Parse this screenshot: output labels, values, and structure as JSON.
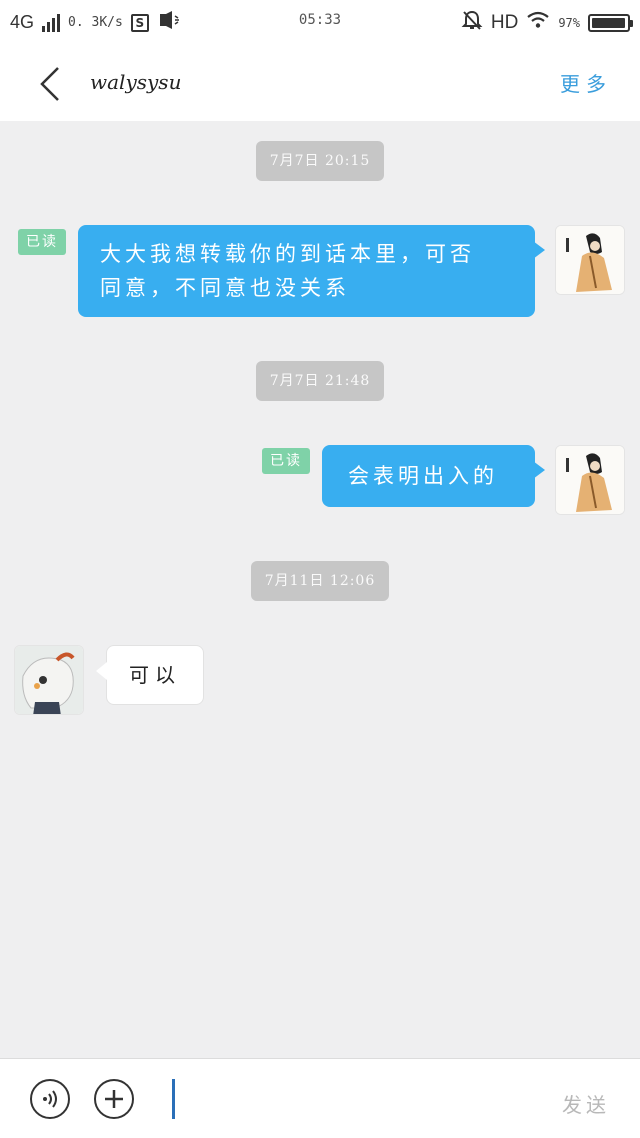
{
  "status_bar": {
    "network": "4G",
    "speed": "0. 3K/s",
    "s_icon_label": "S",
    "time": "05:33",
    "hd": "HD",
    "battery_percent": "97%",
    "battery_level": 0.97
  },
  "header": {
    "title": "walysysu",
    "more_label": "更多"
  },
  "messages": [
    {
      "timestamp": "7月7日 20:15"
    },
    {
      "read_label": "已读",
      "text_line1": "大大我想转载你的到话本里，可否",
      "text_line2": "同意，不同意也没关系"
    },
    {
      "timestamp": "7月7日 21:48"
    },
    {
      "read_label": "已读",
      "text": "会表明出入的"
    },
    {
      "timestamp": "7月11日 12:06"
    },
    {
      "text": "可以"
    }
  ],
  "input_bar": {
    "send_label": "发送"
  },
  "colors": {
    "accent": "#3a9ddc",
    "bubble_out": "#38aef0",
    "read_tag": "#7fd2a8",
    "timestamp_bg": "#c6c6c6",
    "chat_bg": "#efeff0"
  }
}
